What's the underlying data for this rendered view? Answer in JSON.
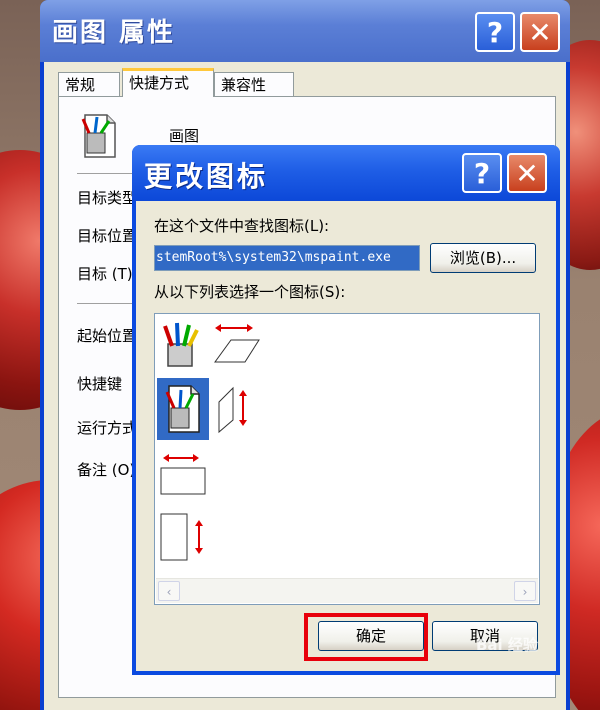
{
  "back_window": {
    "title": "画图 属性",
    "tabs": [
      "常规",
      "快捷方式",
      "兼容性"
    ],
    "active_tab": "快捷方式",
    "app_name": "画图",
    "labels": [
      "目标类型",
      "目标位置",
      "目标 (T)",
      "起始位置",
      "快捷键",
      "运行方式",
      "备注 (O)"
    ]
  },
  "dialog": {
    "title": "更改图标",
    "search_label": "在这个文件中查找图标(L):",
    "file_path": "stemRoot%\\system32\\mspaint.exe",
    "browse_label": "浏览(B)...",
    "list_label": "从以下列表选择一个图标(S):",
    "ok_label": "确定",
    "cancel_label": "取消"
  },
  "watermark": "Bai 经验",
  "colors": {
    "xp_blue": "#0b4ae0",
    "selection": "#316ac5",
    "highlight": "#e8000b",
    "face": "#ece9d8"
  }
}
